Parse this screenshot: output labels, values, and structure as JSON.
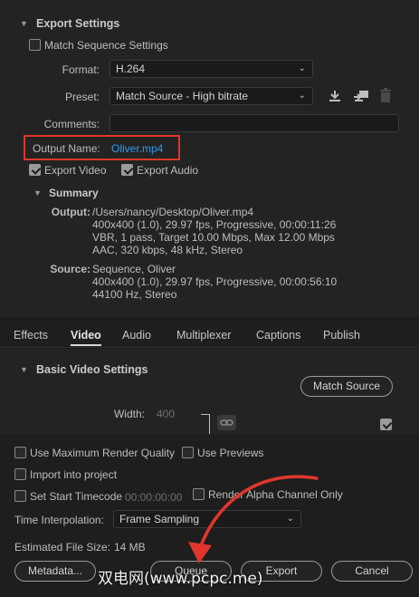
{
  "export_settings": {
    "title": "Export Settings",
    "match_sequence_label": "Match Sequence Settings",
    "format_label": "Format:",
    "format_value": "H.264",
    "preset_label": "Preset:",
    "preset_value": "Match Source - High bitrate",
    "comments_label": "Comments:",
    "comments_value": "",
    "output_name_label": "Output Name:",
    "output_name_value": "Oliver.mp4",
    "export_video_label": "Export Video",
    "export_audio_label": "Export Audio",
    "export_video_checked": true,
    "export_audio_checked": true,
    "highlight_color": "#e0362c"
  },
  "summary": {
    "title": "Summary",
    "output_key": "Output:",
    "output_lines": [
      "/Users/nancy/Desktop/Oliver.mp4",
      "400x400 (1.0), 29.97 fps, Progressive, 00:00:11:26",
      "VBR, 1 pass, Target 10.00 Mbps, Max 12.00 Mbps",
      "AAC, 320 kbps, 48 kHz, Stereo"
    ],
    "source_key": "Source:",
    "source_lines": [
      "Sequence, Oliver",
      "400x400 (1.0), 29.97 fps, Progressive, 00:00:56:10",
      "44100 Hz, Stereo"
    ]
  },
  "tabs": [
    "Effects",
    "Video",
    "Audio",
    "Multiplexer",
    "Captions",
    "Publish"
  ],
  "active_tab": "Video",
  "video": {
    "section_title": "Basic Video Settings",
    "match_source_label": "Match Source",
    "width_label": "Width:",
    "width_value": "400"
  },
  "bottom": {
    "max_render_quality_label": "Use Maximum Render Quality",
    "use_previews_label": "Use Previews",
    "import_into_project_label": "Import into project",
    "set_start_timecode_label": "Set Start Timecode",
    "start_timecode_value": "00:00:00:00",
    "render_alpha_label": "Render Alpha Channel Only",
    "time_interpolation_label": "Time Interpolation:",
    "time_interpolation_value": "Frame Sampling",
    "estimated_size_label": "Estimated File Size:",
    "estimated_size_value": "14 MB",
    "metadata_label": "Metadata...",
    "queue_label": "Queue",
    "export_label": "Export",
    "cancel_label": "Cancel",
    "arrow_color": "#e0362c"
  },
  "watermark": {
    "text": "双电网(www.pcpc.me)"
  }
}
